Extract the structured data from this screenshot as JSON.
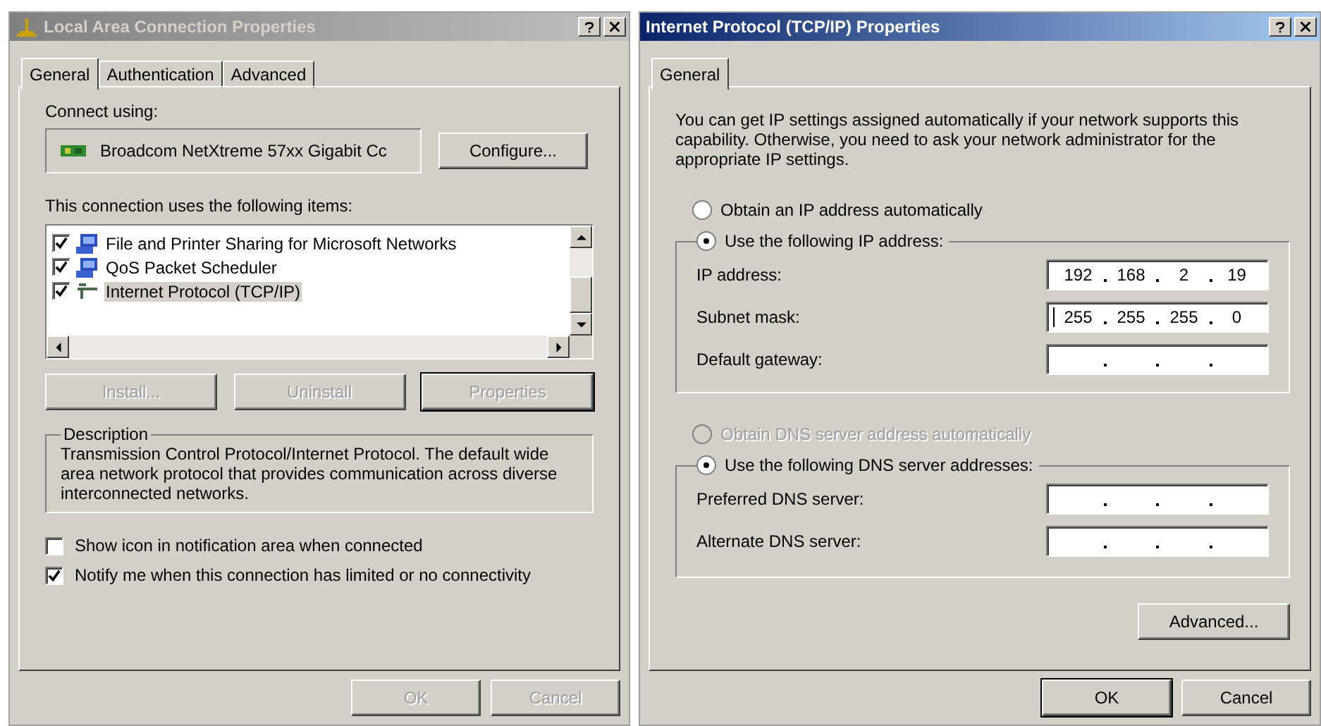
{
  "left_window": {
    "title": "Local Area Connection Properties",
    "active": false,
    "tabs": [
      {
        "label": "General",
        "selected": true
      },
      {
        "label": "Authentication",
        "selected": false
      },
      {
        "label": "Advanced",
        "selected": false
      }
    ],
    "connect_label": "Connect using:",
    "adapter": "Broadcom NetXtreme 57xx Gigabit Cc",
    "configure_button": "Configure...",
    "items_label": "This connection uses the following items:",
    "items": [
      {
        "kind": "service",
        "label": "File and Printer Sharing for Microsoft Networks",
        "checked": true,
        "selected": false
      },
      {
        "kind": "service",
        "label": "QoS Packet Scheduler",
        "checked": true,
        "selected": false
      },
      {
        "kind": "protocol",
        "label": "Internet Protocol (TCP/IP)",
        "checked": true,
        "selected": true
      }
    ],
    "item_buttons": [
      {
        "label": "Install...",
        "disabled": true,
        "default": false
      },
      {
        "label": "Uninstall",
        "disabled": true,
        "default": false
      },
      {
        "label": "Properties",
        "disabled": true,
        "default": true
      }
    ],
    "description": {
      "legend": "Description",
      "text": "Transmission Control Protocol/Internet Protocol. The default wide area network protocol that provides communication across diverse interconnected networks."
    },
    "options": [
      {
        "label": "Show icon in notification area when connected",
        "checked": false
      },
      {
        "label": "Notify me when this connection has limited or no connectivity",
        "checked": true
      }
    ],
    "footer_buttons": [
      {
        "label": "OK",
        "disabled": true,
        "default": false
      },
      {
        "label": "Cancel",
        "disabled": true,
        "default": false
      }
    ]
  },
  "right_window": {
    "title": "Internet Protocol (TCP/IP) Properties",
    "active": true,
    "tabs": [
      {
        "label": "General",
        "selected": true
      }
    ],
    "intro": "You can get IP settings assigned automatically if your network supports this capability. Otherwise, you need to ask your network administrator for the appropriate IP settings.",
    "ip_auto": {
      "label": "Obtain an IP address automatically",
      "selected": false,
      "disabled": false
    },
    "ip_manual": {
      "label": "Use the following IP address:",
      "selected": true,
      "disabled": false
    },
    "ip_fields": [
      {
        "label": "IP address:",
        "octets": [
          "192",
          "168",
          "2",
          "19"
        ],
        "focused": false
      },
      {
        "label": "Subnet mask:",
        "octets": [
          "255",
          "255",
          "255",
          "0"
        ],
        "focused": true
      },
      {
        "label": "Default gateway:",
        "focused": false
      }
    ],
    "dns_auto": {
      "label": "Obtain DNS server address automatically",
      "selected": false,
      "disabled": true
    },
    "dns_manual": {
      "label": "Use the following DNS server addresses:",
      "selected": true,
      "disabled": false
    },
    "dns_fields": [
      {
        "label": "Preferred DNS server:",
        "focused": false
      },
      {
        "label": "Alternate DNS server:",
        "focused": false
      }
    ],
    "advanced_button": "Advanced...",
    "footer_buttons": [
      {
        "label": "OK",
        "disabled": false,
        "default": true
      },
      {
        "label": "Cancel",
        "disabled": false,
        "default": false
      }
    ]
  }
}
